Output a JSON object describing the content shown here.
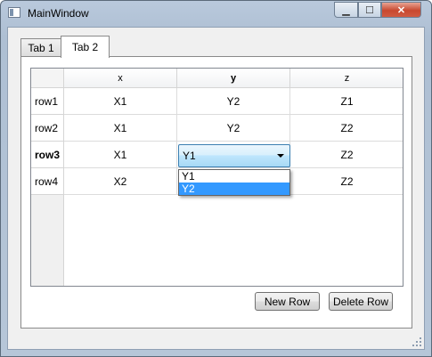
{
  "window": {
    "title": "MainWindow"
  },
  "titlebar_buttons": {
    "minimize": "▁",
    "maximize": "☐",
    "close": "✕"
  },
  "tabs": [
    {
      "label": "Tab 1"
    },
    {
      "label": "Tab 2"
    }
  ],
  "table": {
    "columns": [
      "x",
      "y",
      "z"
    ],
    "rows": [
      {
        "header": "row1",
        "cells": [
          "X1",
          "Y2",
          "Z1"
        ]
      },
      {
        "header": "row2",
        "cells": [
          "X1",
          "Y2",
          "Z2"
        ]
      },
      {
        "header": "row3",
        "cells": [
          "X1",
          "Y1",
          "Z2"
        ]
      },
      {
        "header": "row4",
        "cells": [
          "X2",
          "",
          "Z2"
        ]
      }
    ]
  },
  "combo": {
    "value": "Y1",
    "options": [
      "Y1",
      "Y2"
    ],
    "highlighted": "Y2"
  },
  "buttons": {
    "new_row": "New Row",
    "delete_row": "Delete Row"
  },
  "colors": {
    "selection": "#3399ff",
    "close_button": "#c8482f"
  }
}
